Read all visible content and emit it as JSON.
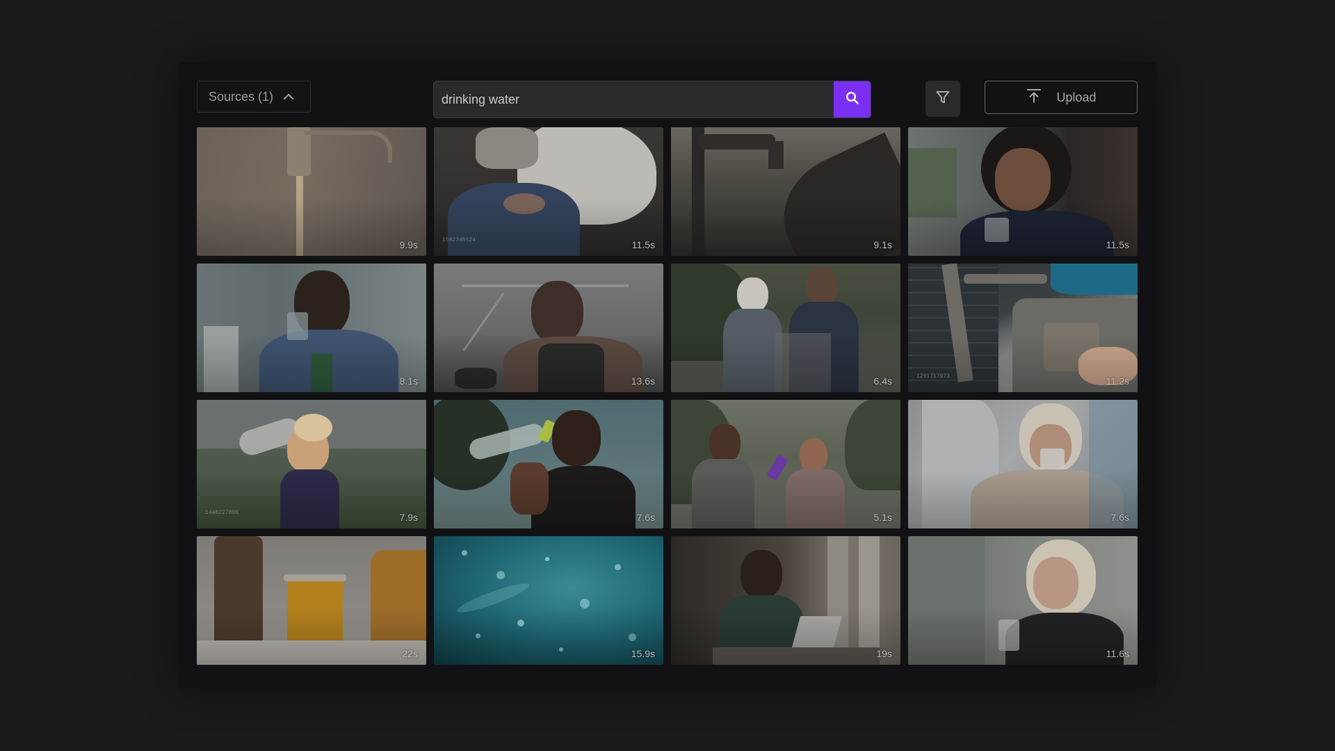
{
  "toolbar": {
    "sources_label": "Sources (1)",
    "search_value": "drinking water",
    "upload_label": "Upload"
  },
  "icons": {
    "sources_toggle": "chevron-up-icon",
    "search": "search-icon",
    "filter": "filter-icon",
    "upload": "upload-icon"
  },
  "colors": {
    "search_button": "#7b2ff2",
    "panel_background": "#121214",
    "page_background": "#1a1a1c"
  },
  "results": [
    {
      "duration": "9.9s",
      "subject": "water running from tap"
    },
    {
      "duration": "11.5s",
      "subject": "pregnant woman holding glass of water",
      "watermark": "1582345524"
    },
    {
      "duration": "9.1s",
      "subject": "hand under outdoor tap at sunset"
    },
    {
      "duration": "11.5s",
      "subject": "smiling woman holding glass by window"
    },
    {
      "duration": "8.1s",
      "subject": "man drinking from glass"
    },
    {
      "duration": "13.6s",
      "subject": "tired woman in gym with hand on face"
    },
    {
      "duration": "6.4s",
      "subject": "elderly couple drinking water on walk"
    },
    {
      "duration": "11.2s",
      "subject": "filling glass at kitchen tap",
      "watermark": "1291717573"
    },
    {
      "duration": "7.9s",
      "subject": "girl drinking from plastic bottle",
      "watermark": "1440227096"
    },
    {
      "duration": "7.6s",
      "subject": "woman drinking from bottle outdoors"
    },
    {
      "duration": "5.1s",
      "subject": "couple drinking water after workout"
    },
    {
      "duration": "7.6s",
      "subject": "woman in hospital bed drinking water"
    },
    {
      "duration": "22s",
      "subject": "glass of orange juice on table"
    },
    {
      "duration": "15.9s",
      "subject": "underwater bubbles"
    },
    {
      "duration": "19s",
      "subject": "woman drinking at laptop desk"
    },
    {
      "duration": "11.6s",
      "subject": "older woman holding glass by window"
    }
  ]
}
